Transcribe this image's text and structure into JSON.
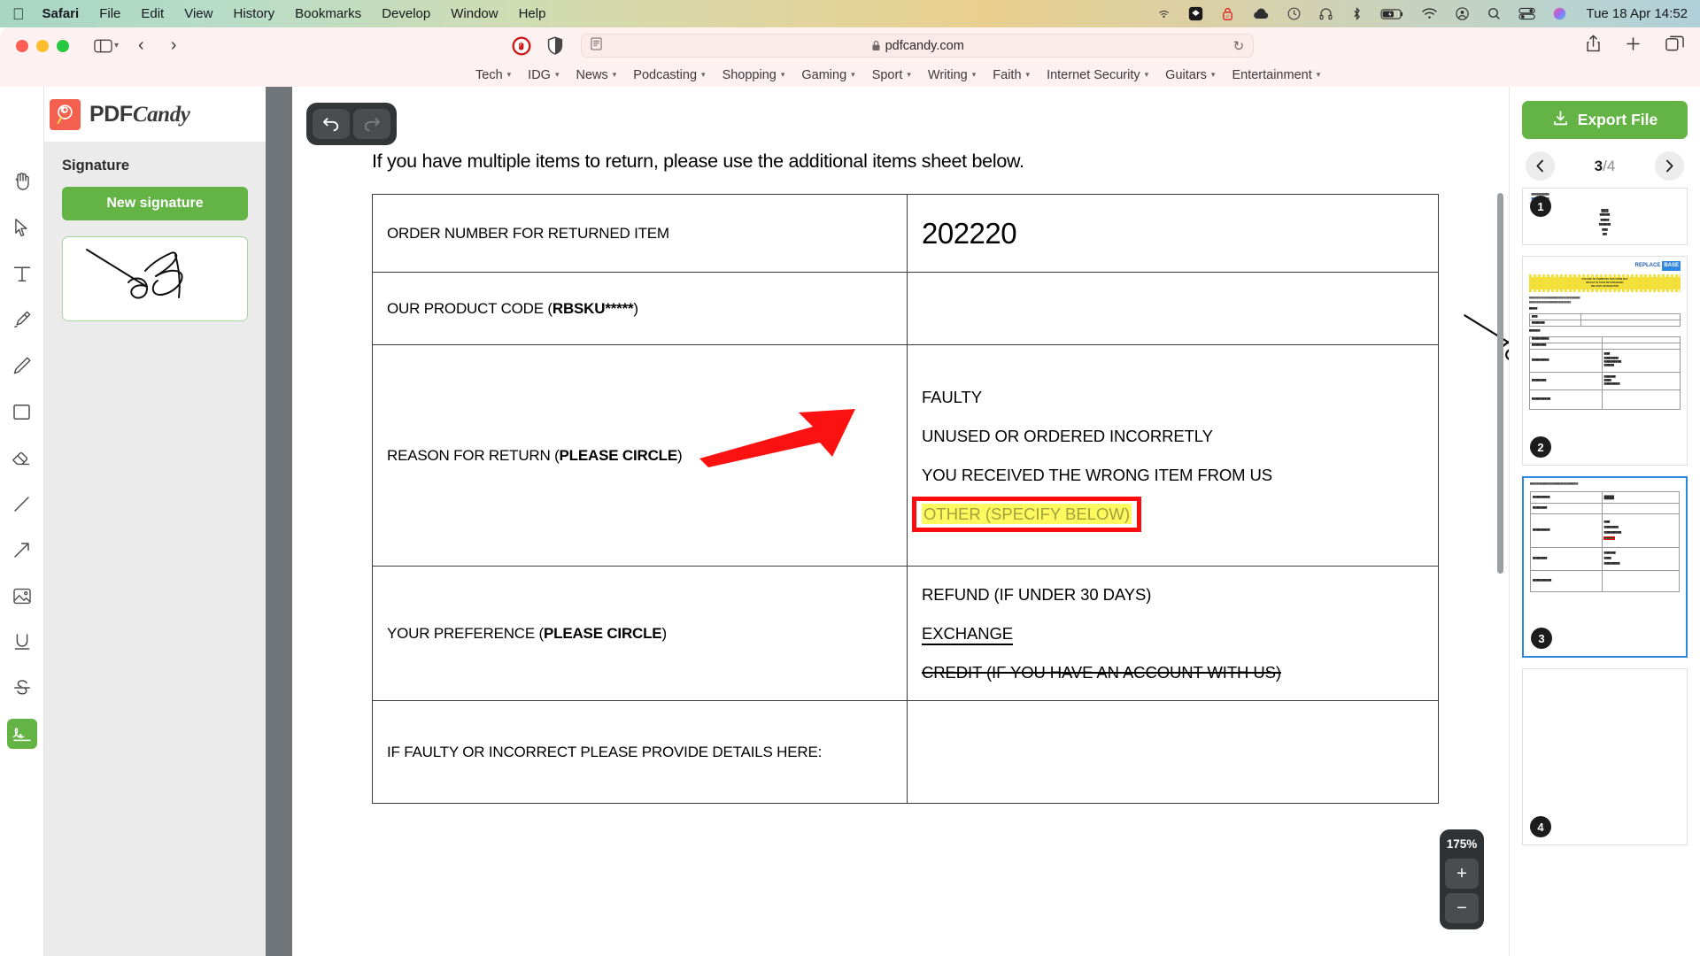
{
  "menubar": {
    "apple": "apple-logo",
    "items": [
      "Safari",
      "File",
      "Edit",
      "View",
      "History",
      "Bookmarks",
      "Develop",
      "Window",
      "Help"
    ],
    "status_icons": [
      "airplay-icon",
      "dropbox-icon",
      "1password-icon",
      "cloud-icon",
      "time-machine-icon",
      "headphones-icon",
      "bluetooth-icon",
      "battery-icon",
      "wifi-icon",
      "control-center-icon",
      "search-icon",
      "display-icon",
      "siri-icon"
    ],
    "clock": "Tue 18 Apr  14:52"
  },
  "browser": {
    "url": "pdfcandy.com",
    "lock": "lock-icon",
    "back": "‹",
    "forward": "›",
    "reload": "↻",
    "bookmarks": [
      {
        "label": "Tech"
      },
      {
        "label": "IDG"
      },
      {
        "label": "News"
      },
      {
        "label": "Podcasting"
      },
      {
        "label": "Shopping"
      },
      {
        "label": "Gaming"
      },
      {
        "label": "Sport"
      },
      {
        "label": "Writing"
      },
      {
        "label": "Faith"
      },
      {
        "label": "Internet Security"
      },
      {
        "label": "Guitars"
      },
      {
        "label": "Entertainment"
      }
    ]
  },
  "sidebar": {
    "brand": {
      "prefix": "PDF",
      "suffix": "Candy",
      "mark": "lollipop-icon"
    },
    "panel_title": "Signature",
    "new_signature_label": "New signature",
    "tools": [
      {
        "name": "hand-tool",
        "icon": "hand-icon"
      },
      {
        "name": "select-tool",
        "icon": "cursor-icon"
      },
      {
        "name": "text-tool",
        "icon": "text-icon"
      },
      {
        "name": "highlighter-tool",
        "icon": "highlighter-icon"
      },
      {
        "name": "pencil-tool",
        "icon": "pencil-icon"
      },
      {
        "name": "rectangle-tool",
        "icon": "rectangle-icon"
      },
      {
        "name": "eraser-tool",
        "icon": "eraser-icon"
      },
      {
        "name": "line-tool",
        "icon": "line-icon"
      },
      {
        "name": "arrow-tool",
        "icon": "arrow-icon"
      },
      {
        "name": "image-tool",
        "icon": "image-icon"
      },
      {
        "name": "underline-tool",
        "icon": "underline-icon"
      },
      {
        "name": "strikethrough-tool",
        "icon": "strikethrough-icon"
      },
      {
        "name": "signature-tool",
        "icon": "signature-icon"
      }
    ]
  },
  "editor": {
    "undo": "undo-icon",
    "redo": "redo-icon",
    "zoom_level": "175%",
    "zoom_in": "+",
    "zoom_out": "−"
  },
  "rightpanel": {
    "export_label": "Export File",
    "export_icon": "download-icon",
    "prev_icon": "chevron-left-icon",
    "next_icon": "chevron-right-icon",
    "current_page": "3",
    "page_total": "/4",
    "thumbnails": [
      {
        "number": "1"
      },
      {
        "number": "2",
        "brand_a": "REPLACE",
        "brand_b": "BASE",
        "banner": [
          "FAILURE TO COMPLETE THIS FORM MAY",
          "RESULT IN YOUR RETURN BEING",
          "DELAYED OR REJECTED"
        ]
      },
      {
        "number": "3"
      },
      {
        "number": "4"
      }
    ]
  },
  "document": {
    "lead": "If you have multiple items to return, please use the additional items sheet below.",
    "rows": [
      {
        "label": "ORDER NUMBER FOR RETURNED ITEM",
        "value": "202220"
      },
      {
        "label_pre": "OUR PRODUCT CODE (",
        "label_bold": "RBSKU*****",
        "label_post": ")",
        "value": "signature-annotation"
      },
      {
        "label_pre": "REASON FOR RETURN (",
        "label_bold": "PLEASE CIRCLE",
        "label_post": ")",
        "options": [
          {
            "text": "FAULTY",
            "style": "plain"
          },
          {
            "text": "UNUSED OR ORDERED INCORRETLY",
            "style": "plain"
          },
          {
            "text": "YOU RECEIVED THE WRONG ITEM FROM US",
            "style": "plain"
          },
          {
            "text": "OTHER (SPECIFY BELOW)",
            "style": "highlighted"
          }
        ]
      },
      {
        "label_pre": "YOUR PREFERENCE (",
        "label_bold": "PLEASE CIRCLE",
        "label_post": ")",
        "options": [
          {
            "text": "REFUND (IF UNDER 30 DAYS)",
            "style": "plain"
          },
          {
            "text": "EXCHANGE",
            "style": "underline"
          },
          {
            "text": "CREDIT (IF YOU HAVE AN ACCOUNT WITH US)",
            "style": "strikethrough"
          }
        ]
      },
      {
        "label": "IF FAULTY OR INCORRECT PLEASE PROVIDE DETAILS HERE:",
        "value": ""
      }
    ],
    "annotations": {
      "arrow": "red-arrow-annotation",
      "highlight_color": "#FDF95F",
      "box_color": "#FC0D0D"
    }
  }
}
